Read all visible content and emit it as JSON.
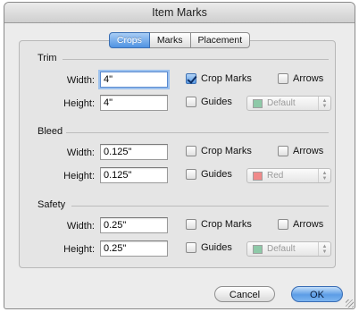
{
  "window": {
    "title": "Item Marks"
  },
  "tabs": [
    {
      "label": "Crops",
      "active": true
    },
    {
      "label": "Marks",
      "active": false
    },
    {
      "label": "Placement",
      "active": false
    }
  ],
  "sections": {
    "trim": {
      "label": "Trim",
      "width_label": "Width:",
      "width_value": "4\"",
      "height_label": "Height:",
      "height_value": "4\"",
      "crop_marks": {
        "label": "Crop Marks",
        "checked": true
      },
      "arrows": {
        "label": "Arrows",
        "checked": false
      },
      "guides": {
        "label": "Guides",
        "checked": false
      },
      "color_popup": {
        "value": "Default",
        "swatch_color": "#8ec9a8",
        "enabled": false
      }
    },
    "bleed": {
      "label": "Bleed",
      "width_label": "Width:",
      "width_value": "0.125\"",
      "height_label": "Height:",
      "height_value": "0.125\"",
      "crop_marks": {
        "label": "Crop Marks",
        "checked": false
      },
      "arrows": {
        "label": "Arrows",
        "checked": false
      },
      "guides": {
        "label": "Guides",
        "checked": false
      },
      "color_popup": {
        "value": "Red",
        "swatch_color": "#f08a8a",
        "enabled": false
      }
    },
    "safety": {
      "label": "Safety",
      "width_label": "Width:",
      "width_value": "0.25\"",
      "height_label": "Height:",
      "height_value": "0.25\"",
      "crop_marks": {
        "label": "Crop Marks",
        "checked": false
      },
      "arrows": {
        "label": "Arrows",
        "checked": false
      },
      "guides": {
        "label": "Guides",
        "checked": false
      },
      "color_popup": {
        "value": "Default",
        "swatch_color": "#8ec9a8",
        "enabled": false
      }
    }
  },
  "buttons": {
    "cancel": "Cancel",
    "ok": "OK"
  }
}
